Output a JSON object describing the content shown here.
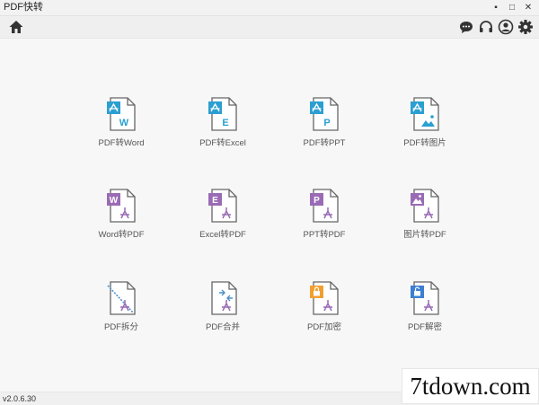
{
  "window": {
    "title": "PDF快转",
    "controls": {
      "minimize": "▪",
      "maximize": "□",
      "close": "✕"
    }
  },
  "toolbar": {
    "left_icon": "home-icon",
    "right_icons": [
      "chat-icon",
      "headset-icon",
      "user-icon",
      "gear-icon"
    ]
  },
  "tiles": [
    {
      "label": "PDF转Word",
      "badge": "W",
      "icon": "pdf-to-word-icon",
      "color": "#2b9fd1"
    },
    {
      "label": "PDF转Excel",
      "badge": "E",
      "icon": "pdf-to-excel-icon",
      "color": "#2b9fd1"
    },
    {
      "label": "PDF转PPT",
      "badge": "P",
      "icon": "pdf-to-ppt-icon",
      "color": "#2b9fd1"
    },
    {
      "label": "PDF转图片",
      "badge": "",
      "icon": "pdf-to-image-icon",
      "color": "#2b9fd1"
    },
    {
      "label": "Word转PDF",
      "badge": "W",
      "icon": "word-to-pdf-icon",
      "color": "#9a6bb5"
    },
    {
      "label": "Excel转PDF",
      "badge": "E",
      "icon": "excel-to-pdf-icon",
      "color": "#9a6bb5"
    },
    {
      "label": "PPT转PDF",
      "badge": "P",
      "icon": "ppt-to-pdf-icon",
      "color": "#9a6bb5"
    },
    {
      "label": "图片转PDF",
      "badge": "",
      "icon": "image-to-pdf-icon",
      "color": "#9a6bb5"
    },
    {
      "label": "PDF拆分",
      "badge": "",
      "icon": "pdf-split-icon",
      "color": "#4a90c8"
    },
    {
      "label": "PDF合并",
      "badge": "",
      "icon": "pdf-merge-icon",
      "color": "#4a90c8"
    },
    {
      "label": "PDF加密",
      "badge": "",
      "icon": "pdf-encrypt-icon",
      "color": "#f0a030"
    },
    {
      "label": "PDF解密",
      "badge": "",
      "icon": "pdf-decrypt-icon",
      "color": "#3d7fd0"
    }
  ],
  "status": {
    "version": "v2.0.6.30"
  },
  "watermark": {
    "text": "7tdown.com"
  }
}
